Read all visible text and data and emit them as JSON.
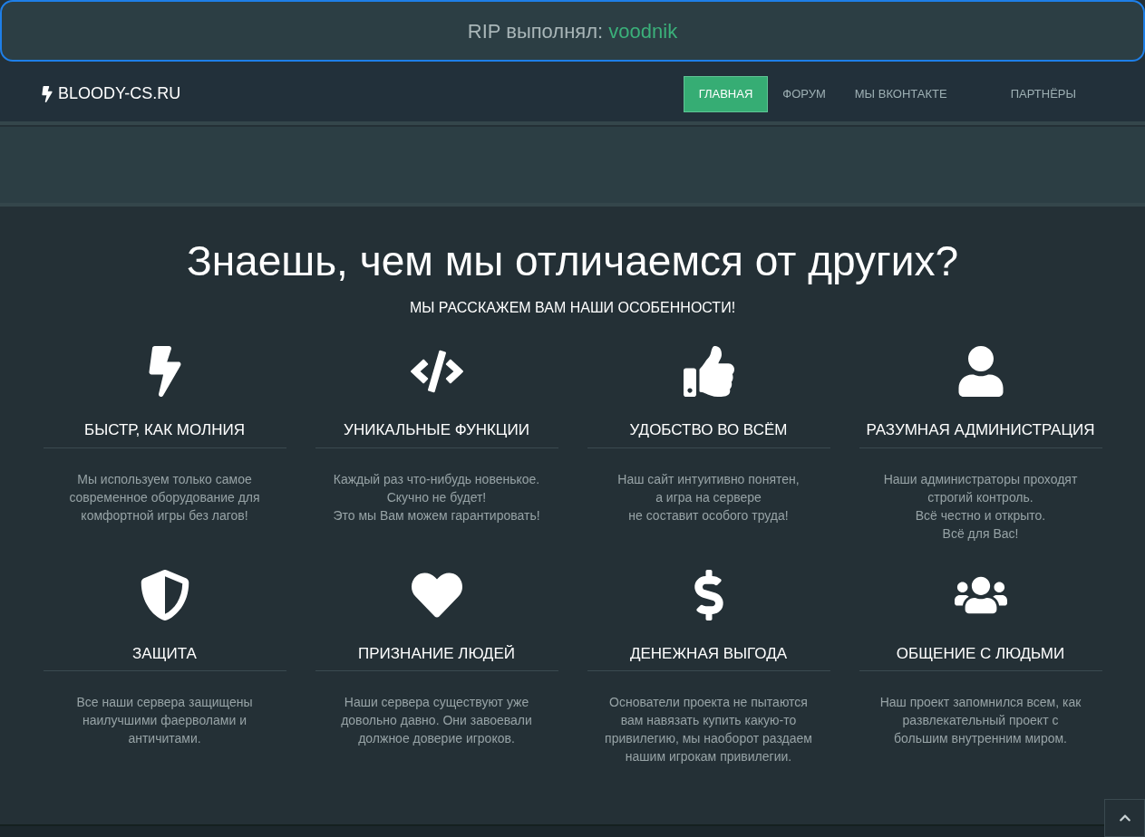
{
  "banner": {
    "text": "RIP выполнял: ",
    "author": "voodnik"
  },
  "navbar": {
    "brand": "BLOODY-CS.RU",
    "items": [
      {
        "label": "ГЛАВНАЯ",
        "selected": true
      },
      {
        "label": "ФОРУМ",
        "selected": false
      },
      {
        "label": "МЫ ВКОНТАКТЕ",
        "selected": false
      },
      {
        "label": "ПАРТНЁРЫ",
        "selected": false
      }
    ]
  },
  "features_section": {
    "title": "Знаешь, чем мы отличаемся от других?",
    "subtitle": "МЫ РАССКАЖЕМ ВАМ НАШИ ОСОБЕННОСТИ!",
    "features": [
      {
        "kind": "bolt",
        "title": "БЫСТР, КАК МОЛНИЯ",
        "lines": [
          "Мы используем только самое",
          "современное оборудование для",
          "комфортной игры без лагов!"
        ]
      },
      {
        "kind": "code",
        "title": "УНИКАЛЬНЫЕ ФУНКЦИИ",
        "lines": [
          "Каждый раз что-нибудь новенькое.",
          "Скучно не будет!",
          "Это мы Вам можем гарантировать!"
        ]
      },
      {
        "kind": "thumb",
        "title": "УДОБСТВО ВО ВСЁМ",
        "lines": [
          "Наш сайт интуитивно понятен,",
          "а игра на сервере",
          "не составит особого труда!"
        ]
      },
      {
        "kind": "user",
        "title": "РАЗУМНАЯ АДМИНИСТРАЦИЯ",
        "lines": [
          "Наши администраторы проходят",
          "строгий контроль.",
          "Всё честно и открыто.",
          "Всё для Вас!"
        ]
      },
      {
        "kind": "shield",
        "title": "ЗАЩИТА",
        "lines": [
          "Все наши сервера защищены",
          "наилучшими фаерволами и",
          "античитами."
        ]
      },
      {
        "kind": "heart",
        "title": "ПРИЗНАНИЕ ЛЮДЕЙ",
        "lines": [
          "Наши сервера существуют уже",
          "довольно давно. Они завоевали",
          "должное доверие игроков."
        ]
      },
      {
        "kind": "dollar",
        "title": "ДЕНЕЖНАЯ ВЫГОДА",
        "lines": [
          "Основатели проекта не пытаются",
          "вам навязать купить какую-то",
          "привилегию, мы наоборот раздаем",
          "нашим игрокам привилегии."
        ]
      },
      {
        "kind": "users",
        "title": "ОБЩЕНИЕ С ЛЮДЬМИ",
        "lines": [
          "Наш проект запомнился всем, как",
          "развлекательный проект с",
          "большим внутренним миром."
        ]
      }
    ]
  }
}
